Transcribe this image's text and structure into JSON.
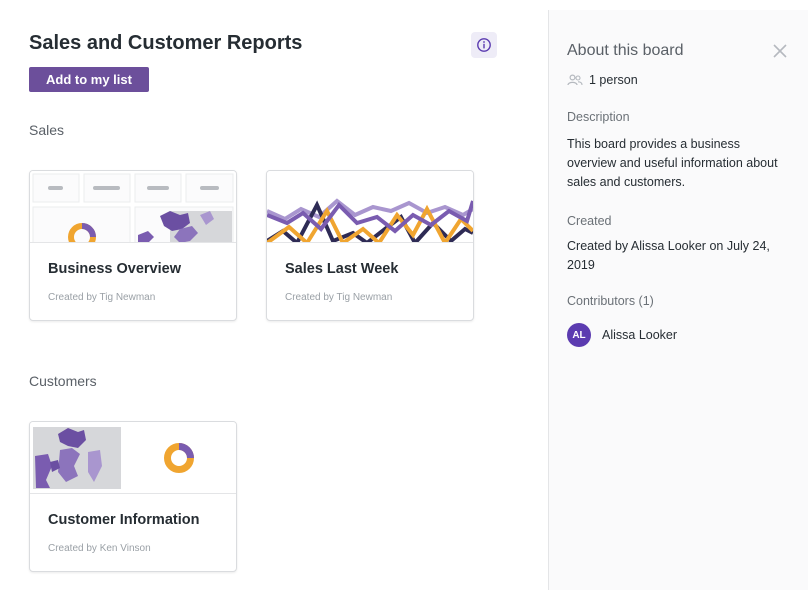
{
  "board": {
    "title": "Sales and Customer Reports",
    "add_button": "Add to my list"
  },
  "sections": [
    {
      "title": "Sales",
      "cards": [
        {
          "title": "Business Overview",
          "creator": "Created by Tig Newman"
        },
        {
          "title": "Sales Last Week",
          "creator": "Created by Tig Newman"
        }
      ]
    },
    {
      "title": "Customers",
      "cards": [
        {
          "title": "Customer Information",
          "creator": "Created by Ken Vinson"
        }
      ]
    }
  ],
  "panel": {
    "title": "About this board",
    "people": "1 person",
    "description_label": "Description",
    "description": "This board provides a business overview and useful information about sales and customers.",
    "created_label": "Created",
    "created": "Created by Alissa Looker on July 24, 2019",
    "contributors_label": "Contributors (1)",
    "contributors": [
      {
        "initials": "AL",
        "name": "Alissa Looker"
      }
    ]
  },
  "colors": {
    "accent": "#6c4f9b",
    "avatar": "#5b3bb0",
    "chart_purple": "#7a5cb0",
    "chart_orange": "#f0a530",
    "chart_navy": "#2e2b55"
  }
}
